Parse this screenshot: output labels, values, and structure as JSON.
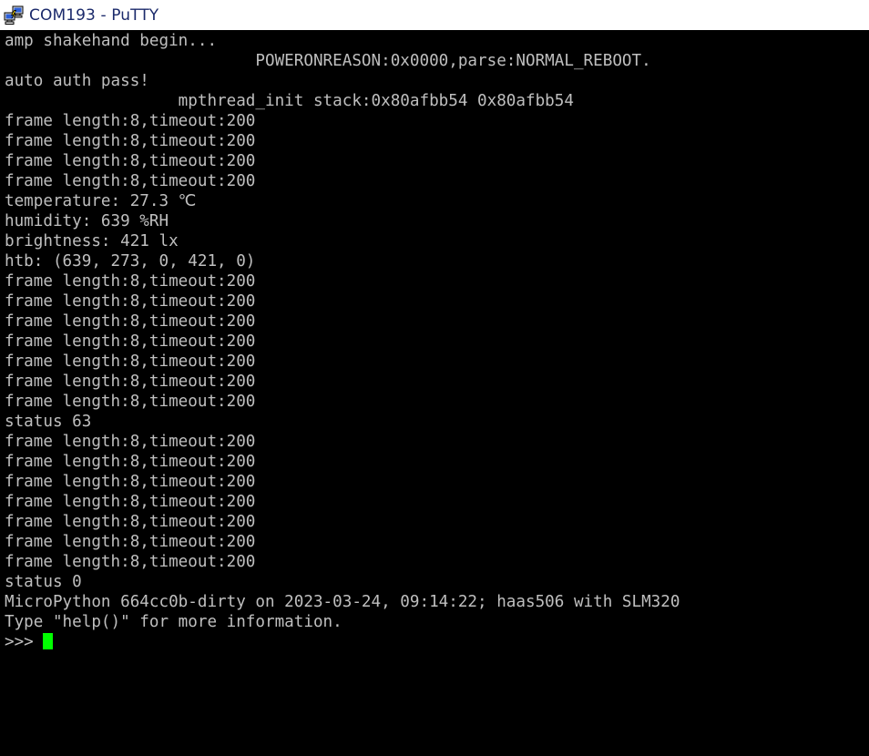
{
  "window": {
    "title": "COM193 - PuTTY",
    "icon": "putty-computer-icon",
    "titlebar_bg": "#ffffff",
    "titlebar_fg": "#1b2a6b"
  },
  "terminal": {
    "background": "#000000",
    "foreground": "#bfbfbf",
    "cursor_color": "#00ff00",
    "prompt": ">>>",
    "columns": 80,
    "lines": [
      "amp shakehand begin...",
      "                          POWERONREASON:0x0000,parse:NORMAL_REBOOT.",
      "auto auth pass!",
      "                  mpthread_init stack:0x80afbb54 0x80afbb54",
      "frame length:8,timeout:200",
      "frame length:8,timeout:200",
      "frame length:8,timeout:200",
      "frame length:8,timeout:200",
      "temperature: 27.3 ℃",
      "humidity: 639 %RH",
      "brightness: 421 lx",
      "htb: (639, 273, 0, 421, 0)",
      "frame length:8,timeout:200",
      "frame length:8,timeout:200",
      "frame length:8,timeout:200",
      "frame length:8,timeout:200",
      "frame length:8,timeout:200",
      "frame length:8,timeout:200",
      "frame length:8,timeout:200",
      "status 63",
      "frame length:8,timeout:200",
      "frame length:8,timeout:200",
      "frame length:8,timeout:200",
      "frame length:8,timeout:200",
      "frame length:8,timeout:200",
      "frame length:8,timeout:200",
      "frame length:8,timeout:200",
      "status 0",
      "MicroPython 664cc0b-dirty on 2023-03-24, 09:14:22; haas506 with SLM320",
      "Type \"help()\" for more information."
    ],
    "readings": {
      "temperature": "27.3",
      "temperature_unit": "℃",
      "humidity": "639",
      "humidity_unit": "%RH",
      "brightness": "421",
      "brightness_unit": "lx",
      "htb": "(639, 273, 0, 421, 0)"
    },
    "status_values": [
      "63",
      "0"
    ],
    "firmware": {
      "name": "MicroPython",
      "build": "664cc0b-dirty",
      "date": "2023-03-24",
      "time": "09:14:22",
      "board": "haas506",
      "module": "SLM320"
    }
  }
}
